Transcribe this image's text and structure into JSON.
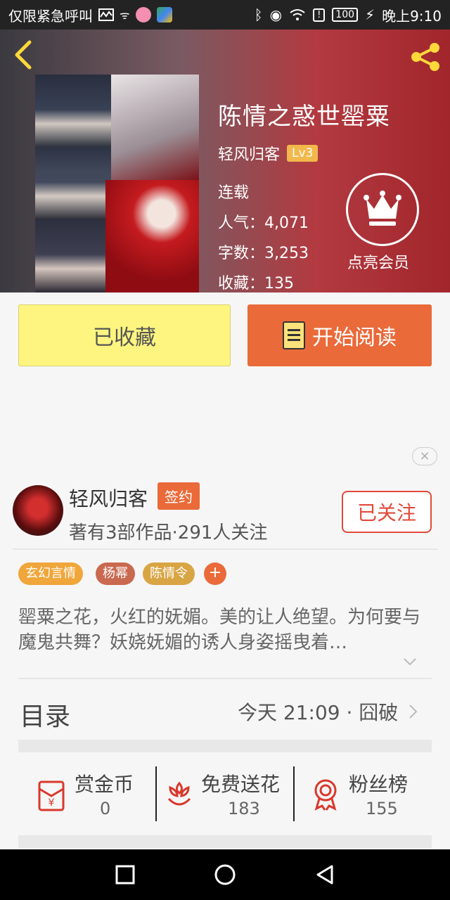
{
  "status_bar": {
    "left_text": "仅限紧急呼叫",
    "battery": "100",
    "time": "晚上9:10"
  },
  "book": {
    "title": "陈情之惑世罂粟",
    "author": "轻风归客",
    "level": "Lv3",
    "status": "连载",
    "popularity": "人气：4,071",
    "word_count": "字数：3,253",
    "favorites": "收藏：135"
  },
  "vip": {
    "label": "点亮会员"
  },
  "actions": {
    "favorite_label": "已收藏",
    "read_label": "开始阅读"
  },
  "author_card": {
    "name": "轻风归客",
    "badge": "签约",
    "info": "著有3部作品·291人关注",
    "follow_label": "已关注"
  },
  "tags": [
    {
      "label": "玄幻言情",
      "color": "#f0a63a"
    },
    {
      "label": "杨幂",
      "color": "#c9694f"
    },
    {
      "label": "陈情令",
      "color": "#d9a544"
    }
  ],
  "tag_add": "+",
  "description": "罂粟之花，火红的妩媚。美的让人绝望。为何要与魔鬼共舞？妖娆妩媚的诱人身姿摇曳着…",
  "toc": {
    "label": "目录",
    "latest": "今天 21:09 · 囧破"
  },
  "stats": [
    {
      "label": "赏金币",
      "value": "0",
      "icon": "red-envelope-icon"
    },
    {
      "label": "免费送花",
      "value": "183",
      "icon": "flower-icon"
    },
    {
      "label": "粉丝榜",
      "value": "155",
      "icon": "medal-icon"
    }
  ],
  "colors": {
    "accent": "#ea6a3a",
    "fav_button": "#fdf580",
    "level_badge": "#f2b84b",
    "follow": "#e24a3a",
    "icon_red": "#d9382b"
  },
  "ad_close": "×"
}
